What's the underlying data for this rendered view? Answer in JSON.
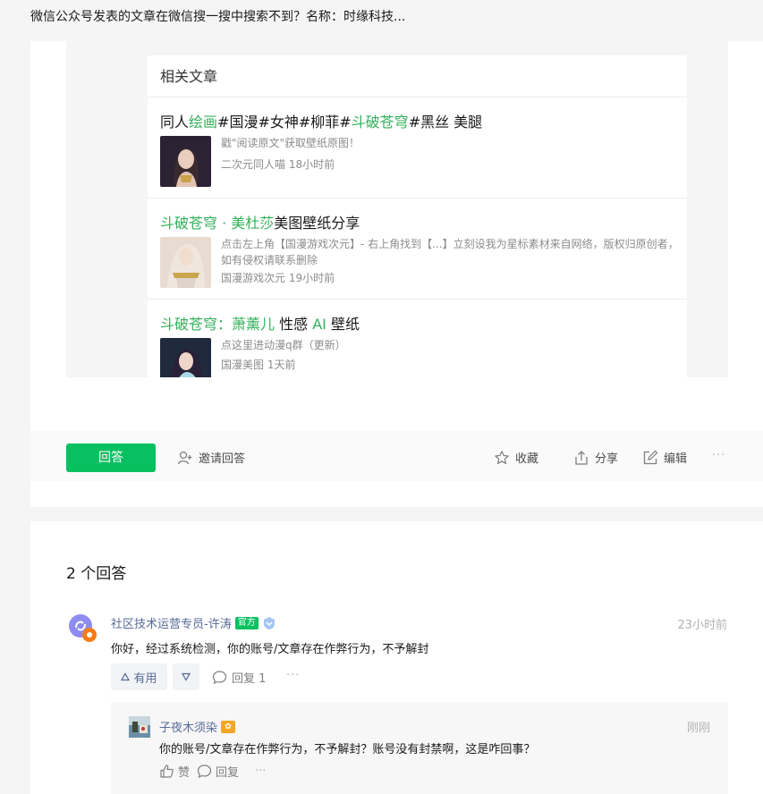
{
  "question": {
    "title": "微信公众号发表的文章在微信搜一搜中搜索不到？名称：时缘科技..."
  },
  "related": {
    "header": "相关文章",
    "articles": [
      {
        "title_parts": [
          "同人",
          "绘画",
          "#国漫#女神#柳菲#",
          "斗破苍穹",
          "#黑丝 美腿"
        ],
        "snippet": "戳\"阅读原文\"获取壁纸原图！",
        "meta": "二次元同人喵  18小时前"
      },
      {
        "title_parts": [
          "斗破苍穹 · 美杜莎",
          "美图壁纸分享"
        ],
        "snippet": "点击左上角【国漫游戏次元】- 右上角找到【...】立刻设我为星标素材来自网络，版权归原创者，如有侵权请联系删除",
        "meta": "国漫游戏次元  19小时前"
      },
      {
        "title_parts": [
          "斗破苍穹：萧薰儿",
          " 性感 ",
          "AI",
          " 壁纸"
        ],
        "snippet": "点这里进动漫q群（更新）",
        "meta": "国漫美图  1天前"
      }
    ]
  },
  "actions": {
    "answer": "回答",
    "invite": "邀请回答",
    "collect": "收藏",
    "share": "分享",
    "edit": "编辑",
    "more": "···"
  },
  "answers": {
    "count_label": "2 个回答",
    "items": [
      {
        "author": "社区技术运营专员-许涛",
        "badge": "官方",
        "time": "23小时前",
        "text": "你好，经过系统检测，你的账号/文章存在作弊行为，不予解封",
        "useful_label": "有用",
        "reply_label": "回复 1",
        "more": "···"
      }
    ],
    "reply": {
      "author": "子夜木须染",
      "time": "刚刚",
      "text": "你的账号/文章存在作弊行为，不予解封？账号没有封禁啊，这是咋回事？",
      "like_label": "赞",
      "reply_label": "回复",
      "more": "···"
    }
  },
  "colors": {
    "accent": "#07c160",
    "highlight": "#33b05b",
    "link": "#576b95"
  }
}
